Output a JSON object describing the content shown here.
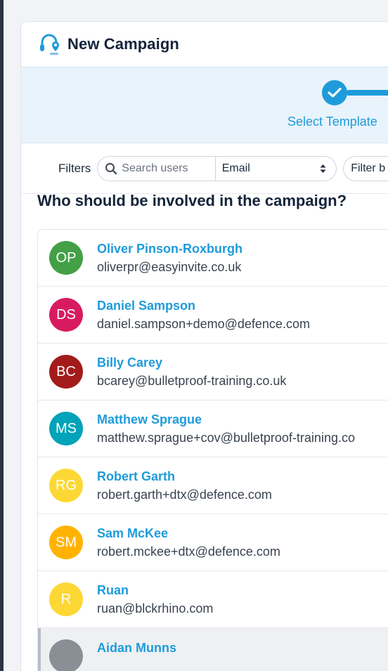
{
  "header": {
    "title": "New Campaign",
    "logo_icon": "headset-pin-icon"
  },
  "stepper": {
    "step_label": "Select Template",
    "accent": "#1f9bdb"
  },
  "filters": {
    "label": "Filters",
    "search_placeholder": "Search users",
    "field_select": "Email",
    "filter_button": "Filter b"
  },
  "question": "Who should be involved in the campaign?",
  "users": [
    {
      "initials": "OP",
      "name": "Oliver Pinson-Roxburgh",
      "email": "oliverpr@easyinvite.co.uk",
      "color": "#43a047"
    },
    {
      "initials": "DS",
      "name": "Daniel Sampson",
      "email": "daniel.sampson+demo@defence.com",
      "color": "#d81b60"
    },
    {
      "initials": "BC",
      "name": "Billy Carey",
      "email": "bcarey@bulletproof-training.co.uk",
      "color": "#a31b1b"
    },
    {
      "initials": "MS",
      "name": "Matthew Sprague",
      "email": "matthew.sprague+cov@bulletproof-training.co",
      "color": "#00a3b8"
    },
    {
      "initials": "RG",
      "name": "Robert Garth",
      "email": "robert.garth+dtx@defence.com",
      "color": "#fdd835"
    },
    {
      "initials": "SM",
      "name": "Sam McKee",
      "email": "robert.mckee+dtx@defence.com",
      "color": "#ffb300"
    },
    {
      "initials": "R",
      "name": "Ruan",
      "email": "ruan@blckrhino.com",
      "color": "#fdd835"
    },
    {
      "initials": "",
      "name": "Aidan Munns",
      "email": "",
      "color": "#8a8f96"
    }
  ]
}
